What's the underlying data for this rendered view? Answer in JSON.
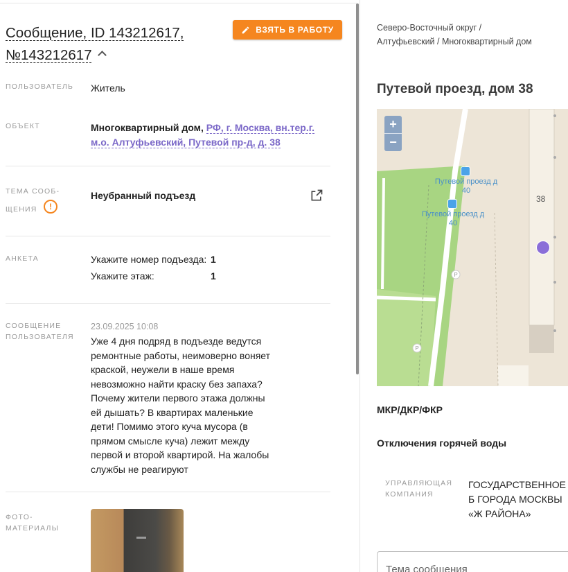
{
  "header": {
    "title": "Сообщение, ID 143212617, №143212617",
    "take_button": "ВЗЯТЬ В РАБОТУ"
  },
  "fields": {
    "user_label": "ПОЛЬЗОВАТЕЛЬ",
    "user_value": "Житель",
    "object_label": "ОБЪЕКТ",
    "object_type": "Многоквартирный дом,",
    "object_address": "РФ, г. Москва, вн.тер.г. м.о. Алтуфьевский, Путевой пр-д, д. 38",
    "topic_label": "ТЕМА СООБ-\nЩЕНИЯ",
    "topic_value": "Неубранный подъезд",
    "survey_label": "АНКЕТА",
    "survey": [
      {
        "q": "Укажите номер подъезда:",
        "a": "1"
      },
      {
        "q": "Укажите этаж:",
        "a": "1"
      }
    ],
    "message_label": "СООБЩЕНИЕ ПОЛЬЗОВАТЕЛЯ",
    "message_date": "23.09.2025 10:08",
    "message_text": "Уже 4 дня подряд в подъезде ведутся ремонтные работы, неимоверно воняет краской, неужели в наше время невозможно найти краску без запаха? Почему жители первого этажа должны ей дышать? В квартирах маленькие дети! Помимо этого куча мусора (в прямом смысле куча) лежит между первой и второй квартирой. На жалобы службы не реагируют",
    "photo_label": "ФОТО-\nМАТЕРИАЛЫ"
  },
  "right": {
    "breadcrumb": "Северо-Восточный округ / Алтуфьевский / Многоквартирный дом",
    "address_title": "Путевой проезд, дом 38",
    "map": {
      "zoom_in": "+",
      "zoom_out": "−",
      "stop_1": "Путевой проезд д 40",
      "stop_2": "Путевой проезд д 40",
      "house_number": "38",
      "parking_1": "P",
      "parking_2": "P"
    },
    "section_1": "МКР/ДКР/ФКР",
    "section_2": "Отключения горячей воды",
    "mgmt_label": "УПРАВЛЯЮЩАЯ КОМПАНИЯ",
    "mgmt_value": "ГОСУДАРСТВЕННОЕ Б ГОРОДА МОСКВЫ «Ж РАЙОНА»",
    "topic_placeholder": "Тема сообщения"
  },
  "colors": {
    "accent": "#f5861f",
    "link": "#7b68c8",
    "pin": "#8a6ed8"
  }
}
